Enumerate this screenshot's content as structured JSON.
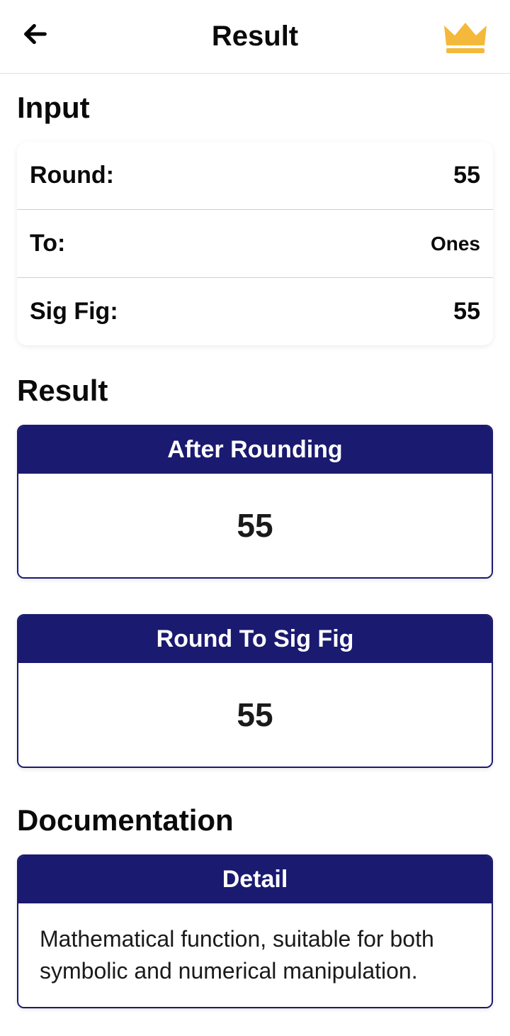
{
  "header": {
    "title": "Result"
  },
  "input": {
    "section_title": "Input",
    "rows": [
      {
        "label": "Round:",
        "value": "55"
      },
      {
        "label": "To:",
        "value": "Ones"
      },
      {
        "label": "Sig Fig:",
        "value": "55"
      }
    ]
  },
  "result": {
    "section_title": "Result",
    "cards": [
      {
        "header": "After Rounding",
        "value": "55"
      },
      {
        "header": "Round To Sig Fig",
        "value": "55"
      }
    ]
  },
  "documentation": {
    "section_title": "Documentation",
    "header": "Detail",
    "body": "Mathematical function, suitable for both symbolic and numerical manipulation."
  }
}
